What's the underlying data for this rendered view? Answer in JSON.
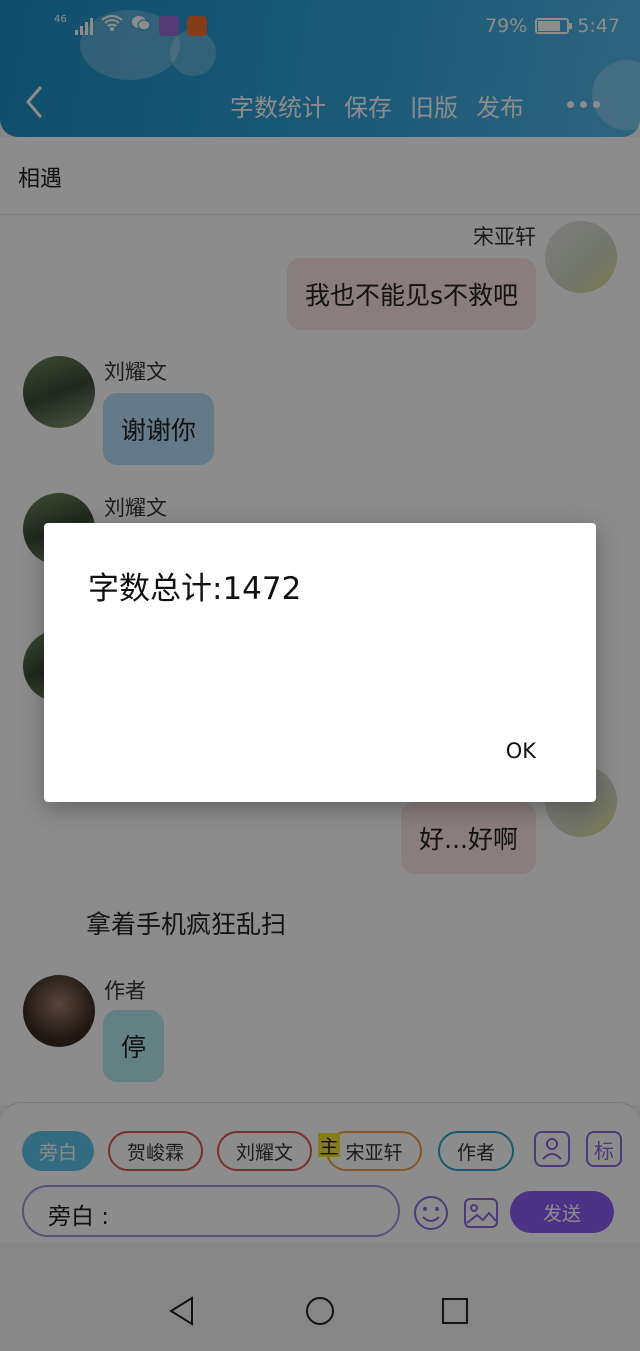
{
  "status_bar": {
    "network": "46",
    "battery": "79%",
    "battery_level": 0.79,
    "time": "5:47"
  },
  "header": {
    "actions": [
      "字数统计",
      "保存",
      "旧版",
      "发布"
    ]
  },
  "chapter_title": "相遇",
  "messages": [
    {
      "name": "宋亚轩",
      "text": "我也不能见s不救吧",
      "side": "right"
    },
    {
      "name": "刘耀文",
      "text": "谢谢你",
      "side": "left"
    },
    {
      "name": "刘耀文",
      "text": "",
      "side": "left"
    },
    {
      "name": "宋亚轩",
      "text": "好...好啊",
      "side": "right"
    },
    {
      "name": "",
      "text": "拿着手机疯狂乱扫",
      "side": "narration"
    },
    {
      "name": "作者",
      "text": "停",
      "side": "left"
    }
  ],
  "composer": {
    "roles": [
      "旁白",
      "贺峻霖",
      "刘耀文",
      "宋亚轩",
      "作者"
    ],
    "main_badge": "主",
    "tag_button": "标",
    "input_value": "旁白 :",
    "send_label": "发送"
  },
  "dialog": {
    "title": "字数总计:1472",
    "ok_label": "OK"
  },
  "colors": {
    "header": "#2a9fd6",
    "send": "#8a5cf0",
    "bubble_right": "#fbe3e3",
    "bubble_left_blue": "#b6dff7",
    "bubble_author": "#b4ecef"
  }
}
